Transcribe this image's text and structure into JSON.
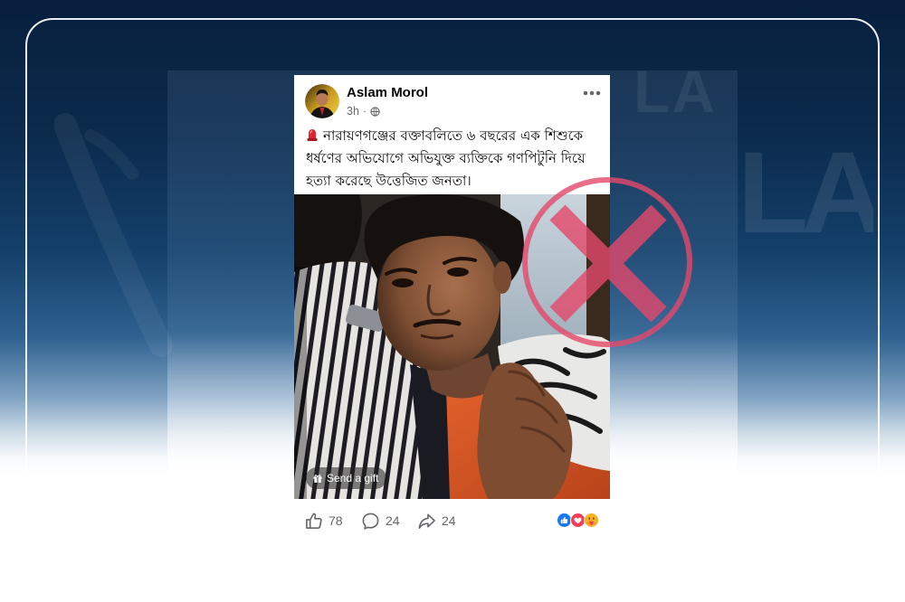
{
  "page": {
    "background_top_color": "#081f3d",
    "background_bottom_color": "#ffffff",
    "frame_color": "#ffffff"
  },
  "watermark": {
    "text": "LA"
  },
  "post": {
    "author_name": "Aslam Morol",
    "avatar_icon": "profile-avatar",
    "timestamp": "3h",
    "separator": "·",
    "privacy_icon": "globe-icon",
    "more_icon": "more-options-icon",
    "text_prefix_icon": "police-light-icon",
    "text_lines": [
      "নারায়ণগঞ্জের বক্তাবলিতে ৬ বছরের এক শিশুকে",
      "ধর্ষণের অভিযোগে অভিযুক্ত ব্যক্তিকে গণপিটুনি দিয়ে",
      "হত্যা করেছে উত্তেজিত জনতা।"
    ],
    "photo": {
      "send_gift_icon": "gift-icon",
      "send_gift_label": "Send a gift"
    }
  },
  "engagement": {
    "like_icon": "thumbs-up-icon",
    "like_count": "78",
    "comment_icon": "comment-icon",
    "comment_count": "24",
    "share_icon": "share-icon",
    "share_count": "24",
    "reactions": [
      "like",
      "love",
      "care"
    ]
  },
  "fact_check_stamp": {
    "icon": "false-x-stamp",
    "color": "#e4486a"
  },
  "colors": {
    "text_primary": "#050505",
    "text_secondary": "#65676b",
    "like_blue": "#1877f2",
    "love_red": "#f33e58",
    "care_yellow": "#f7b125"
  }
}
